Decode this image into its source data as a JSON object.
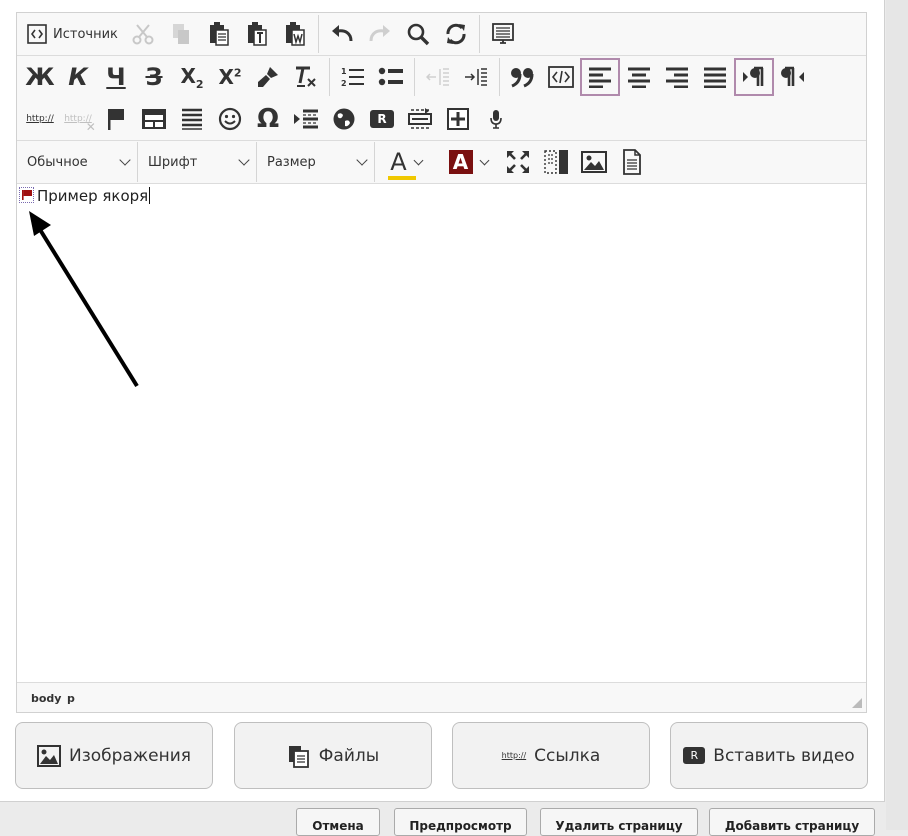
{
  "toolbar": {
    "source_label": "Источник",
    "bold": "Ж",
    "italic": "К",
    "underline": "Ч",
    "strike": "З",
    "subscript": "X",
    "subscript_mark": "2",
    "superscript": "X",
    "superscript_mark": "2",
    "link_text": "http://",
    "unlink_text": "http://",
    "rich_combo_label": "R",
    "format_label": "Обычное",
    "font_label": "Шрифт",
    "size_label": "Размер",
    "text_color_letter": "A",
    "bg_color_letter": "A",
    "text_color_bar": "#f0c800",
    "bg_color_fill": "#7a1010"
  },
  "content": {
    "text": "Пример якоря",
    "flag_color": "#a01010"
  },
  "statusbar": {
    "path": [
      "body",
      "p"
    ]
  },
  "bottom_buttons": {
    "images": "Изображения",
    "files": "Файлы",
    "link_icon_text": "http://",
    "link": "Ссылка",
    "video_icon_text": "R",
    "video": "Вставить видео"
  },
  "actions": {
    "cancel": "Отмена",
    "preview": "Предпросмотр",
    "delete": "Удалить страницу",
    "add": "Добавить страницу"
  },
  "accent": "#b08aac"
}
